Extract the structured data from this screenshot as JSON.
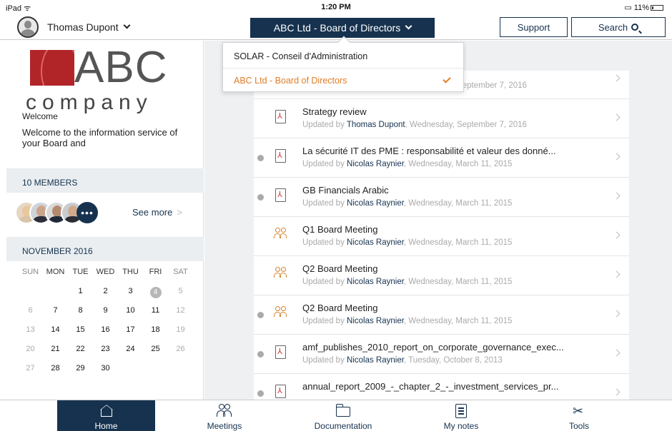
{
  "status_bar": {
    "device": "iPad",
    "time": "1:20 PM",
    "battery": "11%"
  },
  "header": {
    "user_name": "Thomas Dupont",
    "board_selected": "ABC Ltd - Board of Directors",
    "support_label": "Support",
    "search_label": "Search"
  },
  "board_dropdown": {
    "options": [
      {
        "label": "SOLAR - Conseil d'Administration",
        "selected": false
      },
      {
        "label": "ABC Ltd - Board of Directors",
        "selected": true
      }
    ]
  },
  "sidebar": {
    "logo_text": "ABC",
    "logo_subtext": "company",
    "welcome_title": "Welcome",
    "welcome_text": "Welcome to the information service of your Board and",
    "members_header": "10 MEMBERS",
    "members_more": "•••",
    "see_more": "See more",
    "calendar_header": "NOVEMBER 2016",
    "calendar": {
      "weekdays": [
        "SUN",
        "MON",
        "TUE",
        "WED",
        "THU",
        "FRI",
        "SAT"
      ],
      "weeks": [
        [
          "",
          "",
          "1",
          "2",
          "3",
          "4",
          "5"
        ],
        [
          "6",
          "7",
          "8",
          "9",
          "10",
          "11",
          "12"
        ],
        [
          "13",
          "14",
          "15",
          "16",
          "17",
          "18",
          "19"
        ],
        [
          "20",
          "21",
          "22",
          "23",
          "24",
          "25",
          "26"
        ],
        [
          "27",
          "28",
          "29",
          "30",
          "",
          "",
          ""
        ]
      ],
      "today": "4",
      "event_days": [
        "22"
      ]
    }
  },
  "documents": {
    "items": [
      {
        "title": "",
        "author": "Thomas Dupont",
        "date": "Wednesday, September 7, 2016",
        "icon": "pdf-icon",
        "unread": false
      },
      {
        "title": "Strategy review",
        "author": "Thomas Dupont",
        "date": "Wednesday, September 7, 2016",
        "icon": "pdf-icon",
        "unread": false
      },
      {
        "title": "La sécurité IT des PME : responsabilité et valeur des donné...",
        "author": "Nicolas Raynier",
        "date": "Wednesday, March 11, 2015",
        "icon": "pdf-icon",
        "unread": true
      },
      {
        "title": "GB Financials Arabic",
        "author": "Nicolas Raynier",
        "date": "Wednesday, March 11, 2015",
        "icon": "pdf-icon",
        "unread": true
      },
      {
        "title": "Q1 Board Meeting",
        "author": "Nicolas Raynier",
        "date": "Wednesday, March 11, 2015",
        "icon": "meeting-icon",
        "unread": false
      },
      {
        "title": "Q2 Board Meeting",
        "author": "Nicolas Raynier",
        "date": "Wednesday, March 11, 2015",
        "icon": "meeting-icon",
        "unread": false
      },
      {
        "title": "Q2 Board Meeting",
        "author": "Nicolas Raynier",
        "date": "Wednesday, March 11, 2015",
        "icon": "meeting-icon",
        "unread": true
      },
      {
        "title": "amf_publishes_2010_report_on_corporate_governance_exec...",
        "author": "Nicolas Raynier",
        "date": "Tuesday, October 8, 2013",
        "icon": "pdf-icon",
        "unread": true
      },
      {
        "title": "annual_report_2009_-_chapter_2_-_investment_services_pr...",
        "author": "",
        "date": "",
        "icon": "pdf-icon",
        "unread": true
      }
    ],
    "updated_by_prefix": "Updated by "
  },
  "tabbar": {
    "tabs": [
      {
        "label": "Home",
        "active": true
      },
      {
        "label": "Meetings",
        "active": false
      },
      {
        "label": "Documentation",
        "active": false
      },
      {
        "label": "My notes",
        "active": false
      },
      {
        "label": "Tools",
        "active": false
      }
    ]
  },
  "colors": {
    "navy": "#16324f",
    "accent_orange": "#e07d28",
    "brand_red": "#b12529"
  }
}
